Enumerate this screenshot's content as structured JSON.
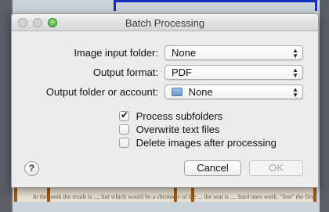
{
  "window": {
    "title": "Batch Processing"
  },
  "form": {
    "image_input_folder": {
      "label": "Image input folder:",
      "value": "None"
    },
    "output_format": {
      "label": "Output format:",
      "value": "PDF"
    },
    "output_folder": {
      "label": "Output folder or account:",
      "value": "None"
    }
  },
  "options": [
    {
      "label": "Process subfolders",
      "checked": true
    },
    {
      "label": "Overwrite text files",
      "checked": false
    },
    {
      "label": "Delete images after processing",
      "checked": false
    }
  ],
  "buttons": {
    "help": "?",
    "cancel": "Cancel",
    "ok": "OK"
  },
  "background": {
    "doc_text": "In the book the result is ..., but which would be a chronicle of the ...   the seat is .... hard ones work. \"line\" the first ... of, the the"
  },
  "colors": {
    "accent_zoom": "#35a82b",
    "bg_border_blue": "#1b2cc4"
  }
}
